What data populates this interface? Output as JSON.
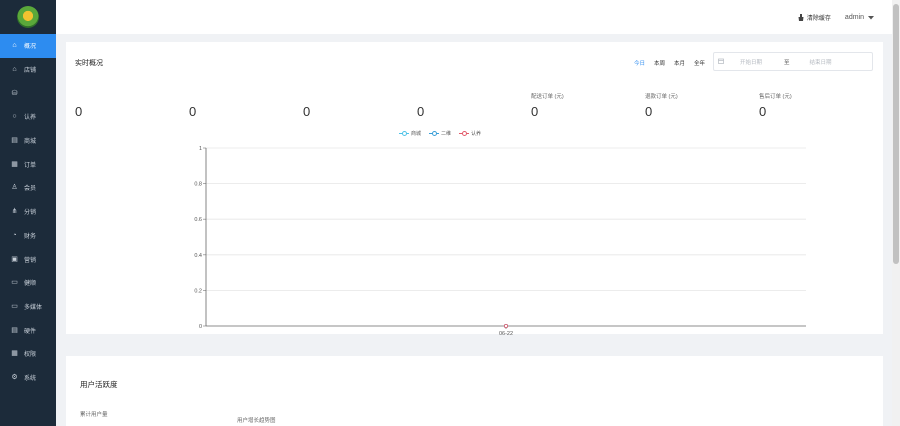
{
  "sidebar": {
    "items": [
      {
        "label": "概况",
        "icon": "home-icon",
        "glyph": "⌂",
        "active": true
      },
      {
        "label": "店铺",
        "icon": "shop-icon",
        "glyph": "⌂",
        "active": false
      },
      {
        "label": "",
        "icon": "database-icon",
        "glyph": "⛁",
        "active": false
      },
      {
        "label": "认养",
        "icon": "adopt-icon",
        "glyph": "○",
        "active": false
      },
      {
        "label": "商城",
        "icon": "mall-icon",
        "glyph": "▤",
        "active": false
      },
      {
        "label": "订单",
        "icon": "order-icon",
        "glyph": "▦",
        "active": false
      },
      {
        "label": "会员",
        "icon": "user-icon",
        "glyph": "♙",
        "active": false
      },
      {
        "label": "分销",
        "icon": "distribution-icon",
        "glyph": "⋔",
        "active": false
      },
      {
        "label": "财务",
        "icon": "finance-icon",
        "glyph": "◔",
        "active": false
      },
      {
        "label": "营销",
        "icon": "marketing-icon",
        "glyph": "▣",
        "active": false
      },
      {
        "label": "健顺",
        "icon": "calendar-icon",
        "glyph": "▭",
        "active": false
      },
      {
        "label": "多媒体",
        "icon": "media-icon",
        "glyph": "▭",
        "active": false
      },
      {
        "label": "硬件",
        "icon": "hardware-icon",
        "glyph": "▤",
        "active": false
      },
      {
        "label": "权限",
        "icon": "permission-icon",
        "glyph": "▦",
        "active": false
      },
      {
        "label": "系统",
        "icon": "settings-icon",
        "glyph": "⚙",
        "active": false
      }
    ]
  },
  "header": {
    "clear_cache": "清除缓存",
    "username": "admin"
  },
  "overview": {
    "title": "实时概况",
    "ranges": [
      "今日",
      "本周",
      "本月",
      "全年"
    ],
    "date_start_placeholder": "开始日期",
    "date_separator": "至",
    "date_end_placeholder": "结束日期",
    "stats": [
      {
        "label": "",
        "value": "0"
      },
      {
        "label": "",
        "value": "0"
      },
      {
        "label": "",
        "value": "0"
      },
      {
        "label": "",
        "value": "0"
      },
      {
        "label": "配送订单 (元)",
        "value": "0"
      },
      {
        "label": "退款订单 (元)",
        "value": "0"
      },
      {
        "label": "售后订单 (元)",
        "value": "0"
      }
    ]
  },
  "chart_data": {
    "type": "line",
    "categories": [
      "06-22"
    ],
    "series": [
      {
        "name": "商城",
        "color": "#4fc3e8",
        "values": [
          0
        ]
      },
      {
        "name": "二维",
        "color": "#3a9fd8",
        "values": [
          0
        ]
      },
      {
        "name": "认养",
        "color": "#e35b6a",
        "values": [
          0
        ]
      }
    ],
    "ylim": [
      0,
      1
    ],
    "yticks": [
      "0",
      "0.2",
      "0.4",
      "0.6",
      "0.8",
      "1"
    ],
    "grid": true,
    "legend": "top-center"
  },
  "activity": {
    "title": "用户活跃度",
    "total_users_label": "累计用户量",
    "trend_label": "用户增长趋势图"
  }
}
